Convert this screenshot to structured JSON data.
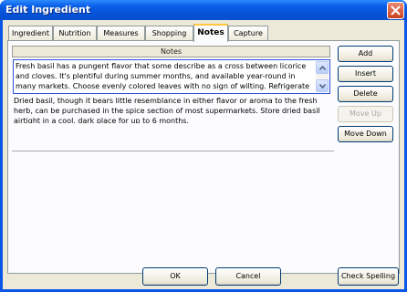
{
  "window": {
    "title": "Edit Ingredient"
  },
  "tabs": [
    {
      "label": "Ingredient"
    },
    {
      "label": "Nutrition"
    },
    {
      "label": "Measures"
    },
    {
      "label": "Shopping"
    },
    {
      "label": "Notes"
    },
    {
      "label": "Capture"
    }
  ],
  "active_tab": "Notes",
  "notes": {
    "header": "Notes",
    "rows": [
      "Fresh basil has a pungent flavor that some describe as a cross between licorice and cloves. It's plentiful during summer months, and available year-round in many markets. Choose evenly colored leaves with no sign of wilting. Refrigerate basil,",
      "Dried basil, though it bears little resemblance in either flavor or aroma to the fresh herb, can be purchased in the spice section of most supermarkets. Store dried basil airtight in a cool, dark place for up to 6 months."
    ]
  },
  "side_buttons": {
    "add": "Add",
    "insert": "Insert",
    "delete": "Delete",
    "move_up": "Move Up",
    "move_down": "Move Down"
  },
  "footer": {
    "ok": "OK",
    "cancel": "Cancel",
    "check_spelling": "Check Spelling"
  }
}
